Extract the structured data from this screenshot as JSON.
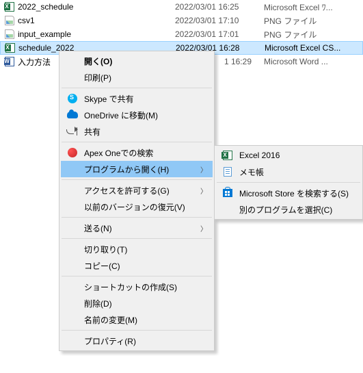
{
  "files": [
    {
      "icon": "excel",
      "name": "2022_schedule",
      "date": "2022/03/01 16:25",
      "type": "Microsoft Excel ﾜ..."
    },
    {
      "icon": "png",
      "name": "csv1",
      "date": "2022/03/01 17:10",
      "type": "PNG ファイル"
    },
    {
      "icon": "png",
      "name": "input_example",
      "date": "2022/03/01 17:01",
      "type": "PNG ファイル"
    },
    {
      "icon": "excel",
      "name": "schedule_2022",
      "date": "2022/03/01 16:28",
      "type": "Microsoft Excel CS...",
      "selected": true
    },
    {
      "icon": "word",
      "name": "入力方法",
      "date": "1 16:29",
      "type": "Microsoft Word ...",
      "date_truncated": true
    }
  ],
  "menu": {
    "open": "開く(O)",
    "print": "印刷(P)",
    "skype": "Skype で共有",
    "onedrive": "OneDrive に移動(M)",
    "share": "共有",
    "apex": "Apex Oneでの検索",
    "openwith": "プログラムから開く(H)",
    "access": "アクセスを許可する(G)",
    "restore": "以前のバージョンの復元(V)",
    "sendto": "送る(N)",
    "cut": "切り取り(T)",
    "copy": "コピー(C)",
    "shortcut": "ショートカットの作成(S)",
    "delete": "削除(D)",
    "rename": "名前の変更(M)",
    "properties": "プロパティ(R)"
  },
  "submenu": {
    "excel": "Excel 2016",
    "memo": "メモ帳",
    "store": "Microsoft Store を検索する(S)",
    "other": "別のプログラムを選択(C)"
  }
}
